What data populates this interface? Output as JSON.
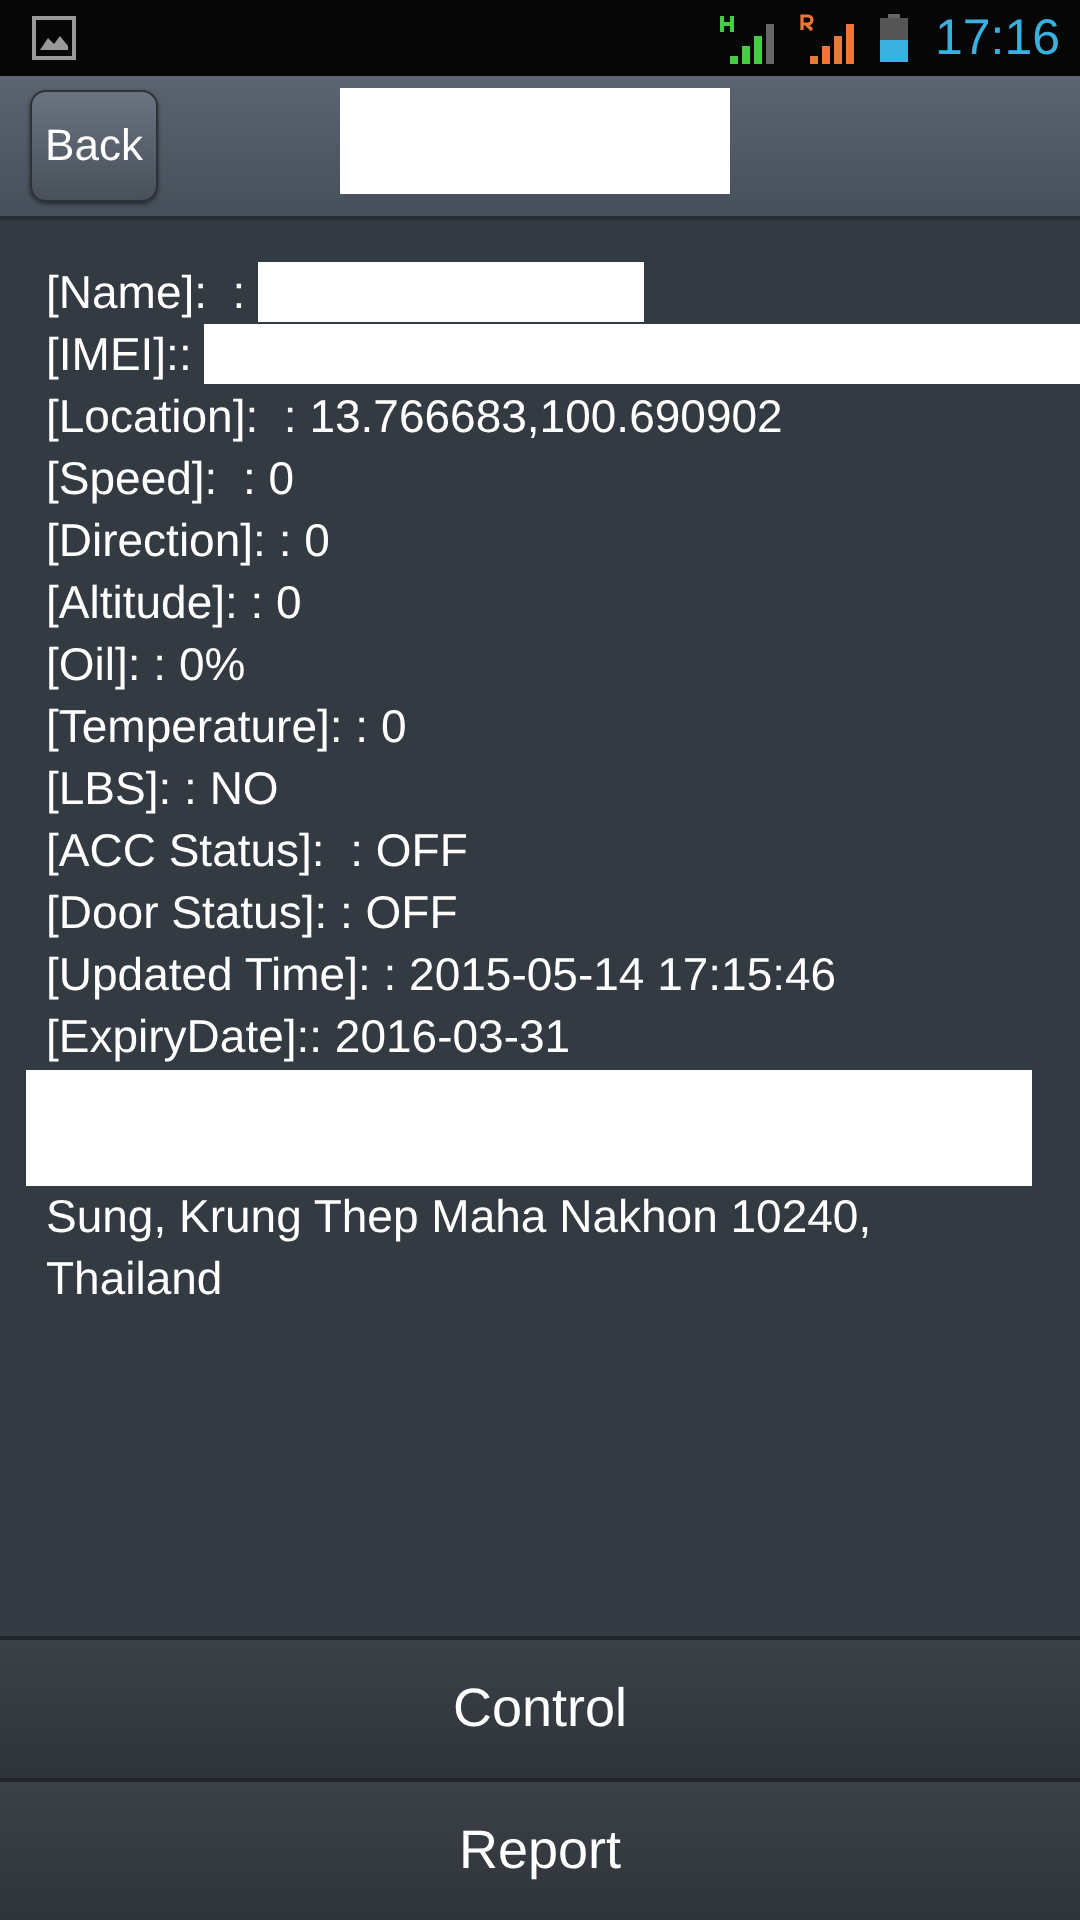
{
  "status_bar": {
    "time": "17:16"
  },
  "toolbar": {
    "back_button": "Back",
    "title_redacted": true
  },
  "details": [
    {
      "kind": "masked",
      "text": "[Name]:  :"
    },
    {
      "kind": "masked_wide",
      "text": "[IMEI]::"
    },
    {
      "kind": "line",
      "text": "[Location]:  : 13.766683,100.690902"
    },
    {
      "kind": "line",
      "text": "[Speed]:  : 0"
    },
    {
      "kind": "line",
      "text": "[Direction]: : 0"
    },
    {
      "kind": "line",
      "text": "[Altitude]: : 0"
    },
    {
      "kind": "line",
      "text": "[Oil]: : 0%"
    },
    {
      "kind": "line",
      "text": "[Temperature]: : 0"
    },
    {
      "kind": "line",
      "text": "[LBS]: : NO"
    },
    {
      "kind": "line",
      "text": "[ACC Status]:  : OFF"
    },
    {
      "kind": "line",
      "text": "[Door Status]: : OFF"
    },
    {
      "kind": "line",
      "text": "[Updated Time]: : 2015-05-14 17:15:46"
    },
    {
      "kind": "line",
      "text": "[ExpiryDate]:: 2016-03-31"
    },
    {
      "kind": "redaction"
    },
    {
      "kind": "line",
      "text": "Sung, Krung Thep Maha Nakhon 10240, Thailand"
    }
  ],
  "buttons": [
    "Control",
    "Report"
  ]
}
